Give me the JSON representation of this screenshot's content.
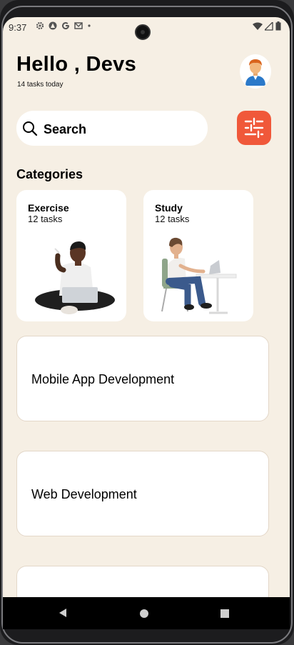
{
  "status_bar": {
    "time": "9:37"
  },
  "header": {
    "greeting": "Hello , Devs",
    "subtitle": "14 tasks today"
  },
  "search": {
    "label": "Search"
  },
  "categories": {
    "title": "Categories",
    "items": [
      {
        "name": "Exercise",
        "count": "12 tasks"
      },
      {
        "name": "Study",
        "count": "12 tasks"
      }
    ]
  },
  "projects": [
    {
      "label": "Mobile App Development"
    },
    {
      "label": "Web Development"
    },
    {
      "label": ""
    }
  ],
  "colors": {
    "background": "#f6efe4",
    "accent": "#f0583a",
    "card": "#ffffff"
  },
  "icons": [
    "settings-icon",
    "sync-icon",
    "google-icon",
    "mail-icon",
    "wifi-icon",
    "signal-icon",
    "battery-icon",
    "avatar-icon",
    "search-icon",
    "filter-icon",
    "back-icon",
    "home-icon",
    "recents-icon"
  ]
}
